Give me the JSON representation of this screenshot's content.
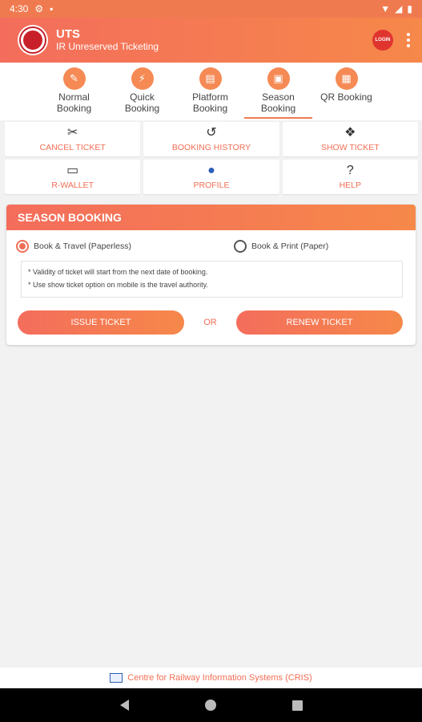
{
  "status_bar": {
    "time": "4:30",
    "icons": [
      "gear-icon",
      "sd-card-icon",
      "wifi-icon",
      "signal-icon",
      "battery-icon"
    ]
  },
  "app_bar": {
    "title": "UTS",
    "subtitle": "IR Unreserved Ticketing",
    "login_label": "LOGIN"
  },
  "tabs": [
    {
      "label": "Normal Booking",
      "icon": "ticket-icon"
    },
    {
      "label": "Quick Booking",
      "icon": "quick-ticket-icon"
    },
    {
      "label": "Platform Booking",
      "icon": "train-icon"
    },
    {
      "label": "Season Booking",
      "icon": "season-pass-icon",
      "active": true
    },
    {
      "label": "QR Booking",
      "icon": "qr-code-icon"
    }
  ],
  "quick_actions": [
    {
      "label": "CANCEL TICKET",
      "icon": "cancel-ticket-icon"
    },
    {
      "label": "BOOKING HISTORY",
      "icon": "history-icon"
    },
    {
      "label": "SHOW TICKET",
      "icon": "show-ticket-icon"
    },
    {
      "label": "R-WALLET",
      "icon": "wallet-icon"
    },
    {
      "label": "PROFILE",
      "icon": "profile-icon"
    },
    {
      "label": "HELP",
      "icon": "help-icon"
    }
  ],
  "season_card": {
    "title": "SEASON BOOKING",
    "option_paperless": "Book & Travel (Paperless)",
    "option_paper": "Book & Print (Paper)",
    "selected_option": "Book & Travel (Paperless)",
    "note_1": "* Validity of ticket will start from the next date of booking.",
    "note_2": "* Use show ticket option on mobile is the travel authority.",
    "issue_button": "ISSUE TICKET",
    "or_text": "OR",
    "renew_button": "RENEW TICKET"
  },
  "footer": {
    "text": "Centre for Railway Information Systems (CRIS)"
  },
  "colors": {
    "brand_orange": "#f07a4f",
    "accent_text": "#f26f55",
    "login_red": "#e0352f"
  }
}
